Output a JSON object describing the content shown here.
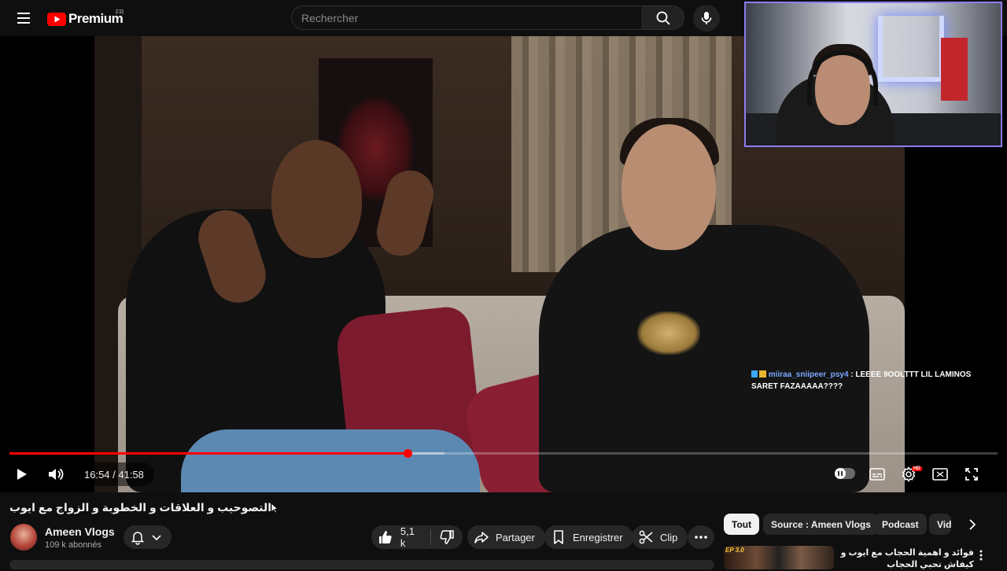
{
  "header": {
    "logo_text": "Premium",
    "region": "FR",
    "search_placeholder": "Rechercher"
  },
  "player": {
    "current_time": "16:54",
    "duration": "41:58",
    "time_display": "16:54 / 41:58",
    "progress_fraction": 0.403,
    "loaded_fraction": 0.44,
    "hd_badge": "HD",
    "chat": {
      "user": "miiraa_sniipeer_psy4",
      "message": "LEEEE 9OOLTTT LIL LAMINOS SARET FAZAAAAA????"
    }
  },
  "video": {
    "title": "التصوحيب و العلاقات و الخطوبة و الزواج مع ايوب",
    "channel_name": "Ameen Vlogs",
    "subscribers": "109 k abonnés"
  },
  "actions": {
    "likes": "5,1 k",
    "share_label": "Partager",
    "save_label": "Enregistrer",
    "clip_label": "Clip"
  },
  "chips": [
    {
      "label": "Tout",
      "active": true
    },
    {
      "label": "Source : Ameen Vlogs",
      "active": false
    },
    {
      "label": "Podcast",
      "active": false
    },
    {
      "label": "Vidéos",
      "active": false
    }
  ],
  "recommendation": {
    "thumb_label": "EP 3.0",
    "title": "فوائد و اهمية الحجاب مع ايوب و كيفاش تحبي الحجاب"
  },
  "colors": {
    "accent": "#ff0000",
    "background": "#0f0f0f",
    "surface": "#272727",
    "webcam_border": "#8e7cf0"
  }
}
